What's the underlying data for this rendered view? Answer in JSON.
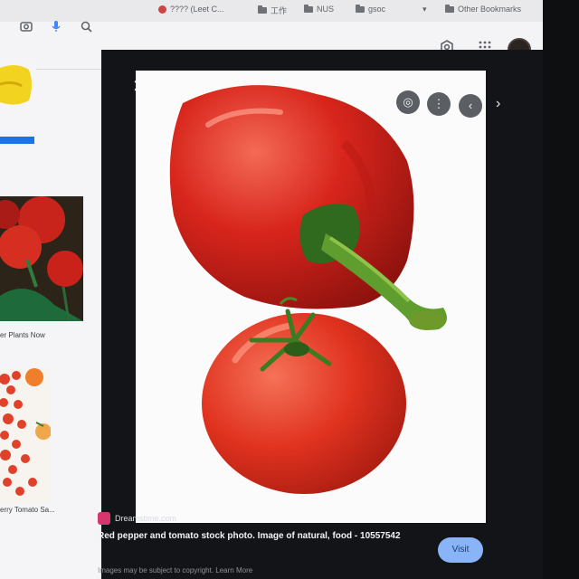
{
  "bookmarks": {
    "items": [
      {
        "label": "???? (Leet C..."
      },
      {
        "label": "工作"
      },
      {
        "label": "NUS"
      },
      {
        "label": "gsoc"
      }
    ],
    "overflow_icon": "chevron-down-icon",
    "other_label": "Other Bookmarks"
  },
  "toolbar": {
    "icons": [
      "camera-icon",
      "mic-icon",
      "search-icon",
      "settings-icon",
      "apps-grid-icon",
      "avatar"
    ]
  },
  "results": {
    "badge": "",
    "captions": [
      "er Plants Now",
      "erry Tomato Sa..."
    ]
  },
  "viewer": {
    "controls": [
      "close-icon",
      "lens-icon",
      "more-icon",
      "prev-icon",
      "next-icon"
    ],
    "source": "Dreamstime.com",
    "title": "Red pepper and tomato stock photo. Image of natural, food - 10557542",
    "visit_label": "Visit",
    "disclaimer": "Images may be subject to copyright. Learn More"
  },
  "colors": {
    "accent": "#8ab4f8",
    "viewer_bg": "#131417",
    "pepper_red": "#d8251c",
    "tomato_red": "#e0321f"
  }
}
